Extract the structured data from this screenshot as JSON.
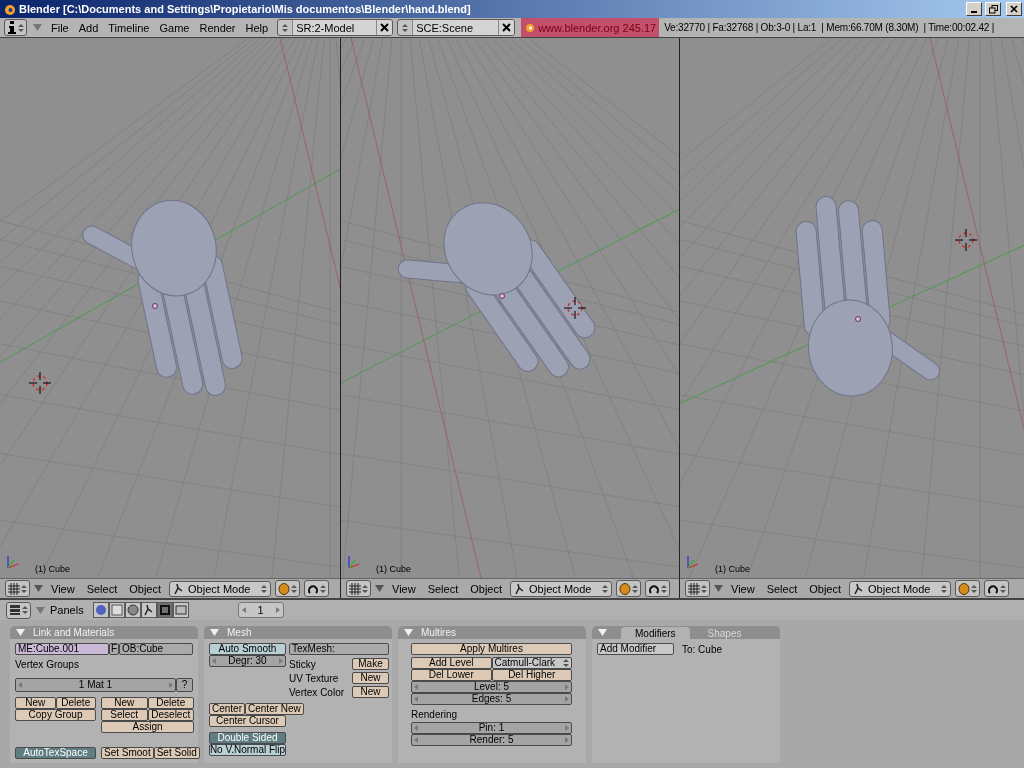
{
  "window": {
    "title": "Blender [C:\\Documents and Settings\\Propietario\\Mis documentos\\Blender\\hand.blend]"
  },
  "menubar": {
    "menus": [
      "File",
      "Add",
      "Timeline",
      "Game",
      "Render",
      "Help"
    ],
    "selectors": [
      {
        "kind": "screen",
        "value": "SR:2-Model"
      },
      {
        "kind": "scene",
        "value": "SCE:Scene"
      }
    ],
    "version": "www.blender.org 245.17",
    "stats": "Ve:32770 | Fa:32768 | Ob:3-0 | La:1  | Mem:66.70M (8.30M)  | Time:00:02.42 |"
  },
  "viewports": [
    {
      "label": "(1) Cube",
      "menus": [
        "View",
        "Select",
        "Object"
      ],
      "mode": "Object Mode"
    },
    {
      "label": "(1) Cube",
      "menus": [
        "View",
        "Select",
        "Object"
      ],
      "mode": "Object Mode"
    },
    {
      "label": "(1) Cube",
      "menus": [
        "View",
        "Select",
        "Object"
      ],
      "mode": "Object Mode"
    }
  ],
  "buttons_window": {
    "header_label": "Panels",
    "context_tabs": [
      {
        "selected": false
      },
      {
        "selected": false
      },
      {
        "selected": false
      },
      {
        "selected": false
      },
      {
        "selected": true
      },
      {
        "selected": false
      }
    ],
    "frame": "1"
  },
  "link_materials": {
    "title": "Link and Materials",
    "mesh_field": "ME:Cube.001",
    "fake_user": "F",
    "object_field": "OB:Cube",
    "vertex_groups_label": "Vertex Groups",
    "material_slot": "1 Mat 1",
    "help": "?",
    "group_buttons": [
      "New",
      "Delete",
      "Copy Group"
    ],
    "material_buttons": [
      "New",
      "Delete",
      "Select",
      "Deselect",
      "Assign"
    ],
    "autotex": {
      "label": "AutoTexSpace",
      "on": true
    },
    "shading_buttons": [
      "Set Smoot",
      "Set Solid"
    ]
  },
  "mesh": {
    "title": "Mesh",
    "auto_smooth": {
      "label": "Auto Smooth",
      "on": false
    },
    "degree": "Degr: 30",
    "texmesh": "TexMesh:",
    "rows": [
      {
        "label": "Sticky",
        "button": "Make"
      },
      {
        "label": "UV Texture",
        "button": "New"
      },
      {
        "label": "Vertex Color",
        "button": "New"
      }
    ],
    "center_buttons": [
      "Center",
      "Center New",
      "Center Cursor"
    ],
    "toggles": [
      {
        "label": "Double Sided",
        "on": true
      },
      {
        "label": "No V.Normal Flip",
        "on": false
      }
    ]
  },
  "multires": {
    "title": "Multires",
    "apply": "Apply Multires",
    "add_level": "Add Level",
    "subdiv_type": "Catmull-Clark",
    "del_lower": "Del Lower",
    "del_higher": "Del Higher",
    "fields": [
      "Level: 5",
      "Edges: 5"
    ],
    "rendering_label": "Rendering",
    "render_fields": [
      "Pin: 1",
      "Render: 5"
    ]
  },
  "modifiers": {
    "tabs": [
      {
        "label": "Modifiers",
        "selected": true
      },
      {
        "label": "Shapes",
        "selected": false
      }
    ],
    "add": "Add Modifier",
    "target": "To: Cube"
  }
}
